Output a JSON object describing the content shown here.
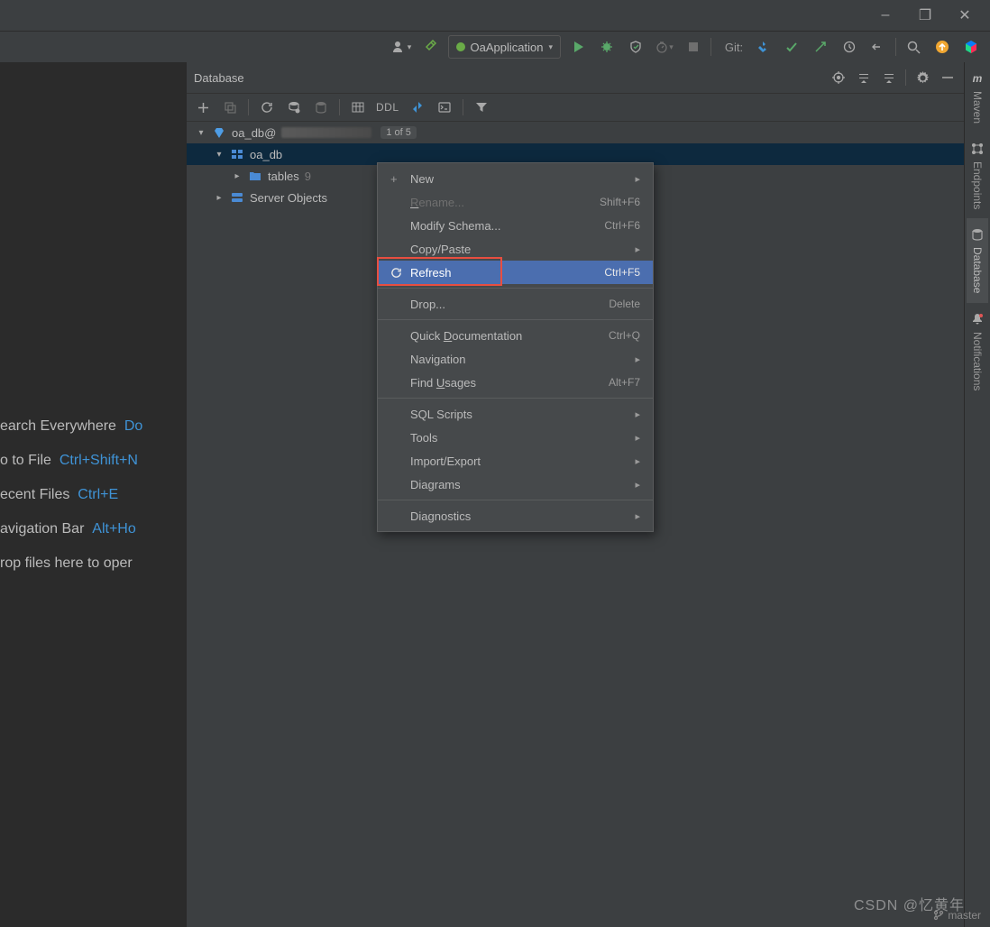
{
  "window": {
    "minimize": "–",
    "restore": "❐",
    "close": "✕"
  },
  "toolbar": {
    "runconfig": "OaApplication",
    "git": "Git:"
  },
  "dbpanel": {
    "title": "Database",
    "tree": {
      "ds_name": "oa_db@",
      "ds_badge": "1 of 5",
      "db_name": "oa_db",
      "tables": "tables",
      "tables_count": "9",
      "server_objects": "Server Objects"
    }
  },
  "dbtoolbar": {
    "ddl": "DDL"
  },
  "context": {
    "new": "New",
    "rename": "Rename...",
    "rename_sc": "Shift+F6",
    "modify": "Modify Schema...",
    "modify_sc": "Ctrl+F6",
    "copy": "Copy/Paste",
    "refresh": "Refresh",
    "refresh_sc": "Ctrl+F5",
    "drop": "Drop...",
    "drop_sc": "Delete",
    "quickdoc": "Quick Documentation",
    "quickdoc_sc": "Ctrl+Q",
    "navigation": "Navigation",
    "findusages": "Find Usages",
    "findusages_sc": "Alt+F7",
    "sqlscripts": "SQL Scripts",
    "tools": "Tools",
    "importexport": "Import/Export",
    "diagrams": "Diagrams",
    "diagnostics": "Diagnostics"
  },
  "hints": {
    "h1a": "earch Everywhere",
    "h1b": "Do",
    "h2a": "o to File",
    "h2b": "Ctrl+Shift+N",
    "h3a": "ecent Files",
    "h3b": "Ctrl+E",
    "h4a": "avigation Bar",
    "h4b": "Alt+Ho",
    "h5a": "rop files here to oper"
  },
  "rightbar": {
    "maven": "Maven",
    "endpoints": "Endpoints",
    "database": "Database",
    "notifications": "Notifications"
  },
  "status": {
    "branch": "master"
  },
  "watermark": "CSDN @忆黄年"
}
